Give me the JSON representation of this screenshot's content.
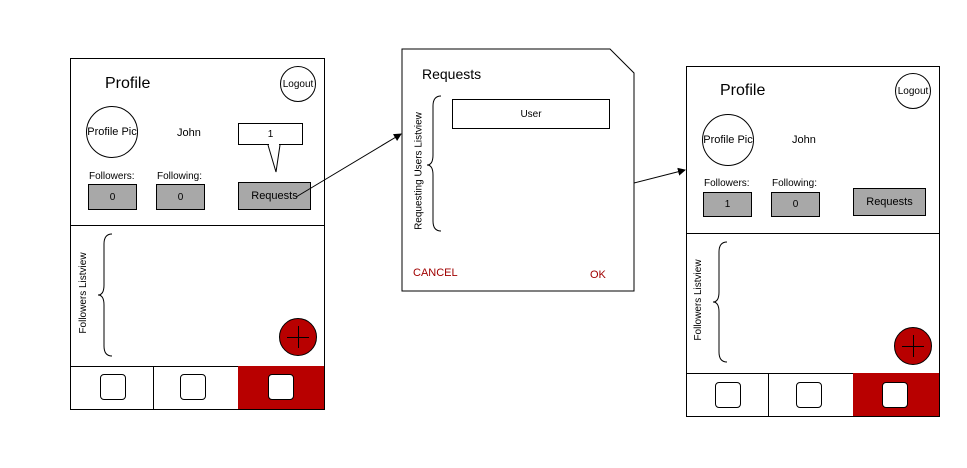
{
  "profile_screen_before": {
    "title": "Profile",
    "logout_label": "Logout",
    "profile_pic_label": "Profile Pic",
    "username": "John",
    "notification_count": "1",
    "followers_label": "Followers:",
    "followers_count": "0",
    "following_label": "Following:",
    "following_count": "0",
    "requests_label": "Requests",
    "listview_label": "Followers Listview"
  },
  "requests_dialog": {
    "title": "Requests",
    "user_row_label": "User",
    "listview_label": "Requesting Users Listview",
    "cancel_label": "CANCEL",
    "ok_label": "OK"
  },
  "profile_screen_after": {
    "title": "Profile",
    "logout_label": "Logout",
    "profile_pic_label": "Profile Pic",
    "username": "John",
    "followers_label": "Followers:",
    "followers_count": "1",
    "following_label": "Following:",
    "following_count": "0",
    "requests_label": "Requests",
    "listview_label": "Followers Listview"
  },
  "colors": {
    "accent_red": "#b80000",
    "button_gray": "#a8a8a8",
    "action_text": "#a00000"
  },
  "icons": [
    "brace-icon",
    "plus-icon",
    "square-nav-icon",
    "arrow-icon"
  ]
}
